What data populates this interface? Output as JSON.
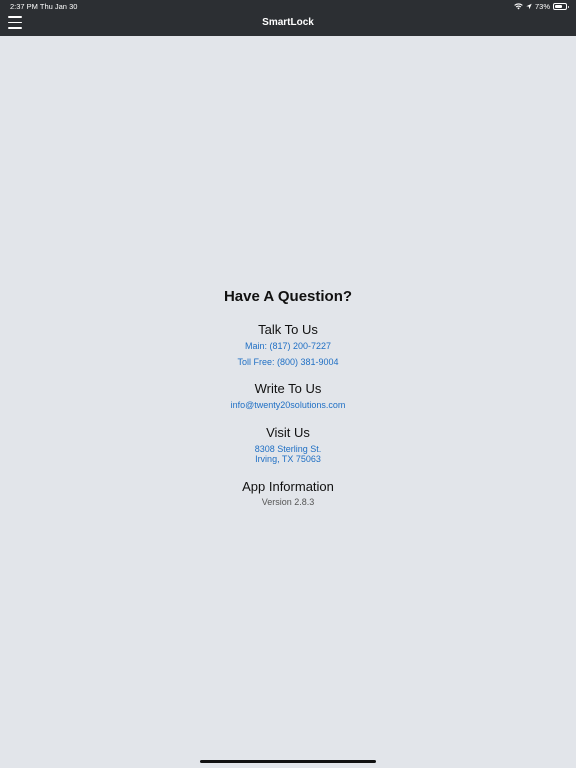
{
  "status_bar": {
    "time_date": "2:37 PM   Thu Jan 30",
    "battery_text": "73%",
    "battery_level": 0.73,
    "icons": [
      "wifi-icon",
      "location-arrow-icon",
      "battery-icon"
    ]
  },
  "nav": {
    "title": "SmartLock",
    "menu_icon": "hamburger-menu-icon"
  },
  "contact": {
    "heading": "Have A Question?",
    "talk": {
      "title": "Talk To Us",
      "main_phone": "Main: (817) 200-7227",
      "toll_free": "Toll Free: (800) 381-9004"
    },
    "write": {
      "title": "Write To Us",
      "email": "info@twenty20solutions.com"
    },
    "visit": {
      "title": "Visit Us",
      "address_line1": "8308 Sterling St.",
      "address_line2": "Irving, TX 75063"
    },
    "app_info": {
      "title": "App Information",
      "version": "Version 2.8.3"
    }
  },
  "colors": {
    "topbar": "#2c2f33",
    "background": "#e2e5ea",
    "link": "#1f6fc4"
  }
}
